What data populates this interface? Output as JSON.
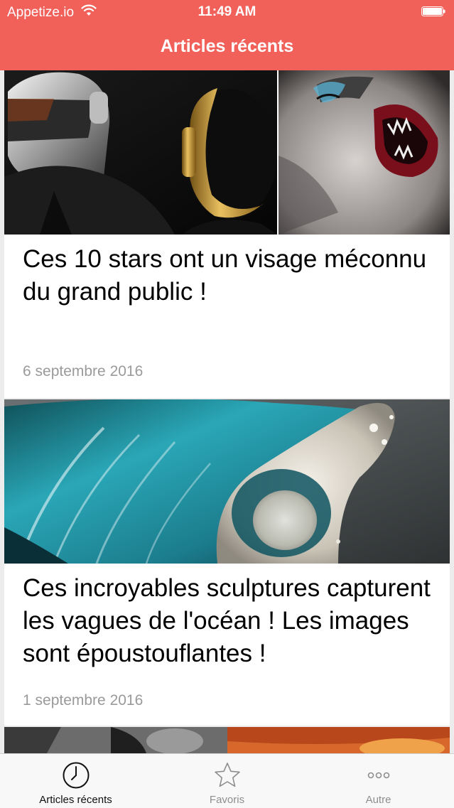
{
  "status_bar": {
    "carrier": "Appetize.io",
    "time": "11:49 AM"
  },
  "header": {
    "title": "Articles récents",
    "color": "#f1615a"
  },
  "articles": [
    {
      "title": "Ces 10 stars ont un visage méconnu du grand public !",
      "date": "6 septembre 2016",
      "image": "daft-punk-and-vampire-collage"
    },
    {
      "title": "Ces incroyables sculptures capturent les vagues de l'océan ! Les images sont époustouflantes !",
      "date": "1 septembre 2016",
      "image": "glass-wave-sculpture"
    },
    {
      "image": "partial-collage"
    }
  ],
  "tabbar": {
    "items": [
      {
        "label": "Articles récents",
        "icon": "clock-icon",
        "active": true
      },
      {
        "label": "Favoris",
        "icon": "star-icon",
        "active": false
      },
      {
        "label": "Autre",
        "icon": "more-icon",
        "active": false
      }
    ]
  }
}
